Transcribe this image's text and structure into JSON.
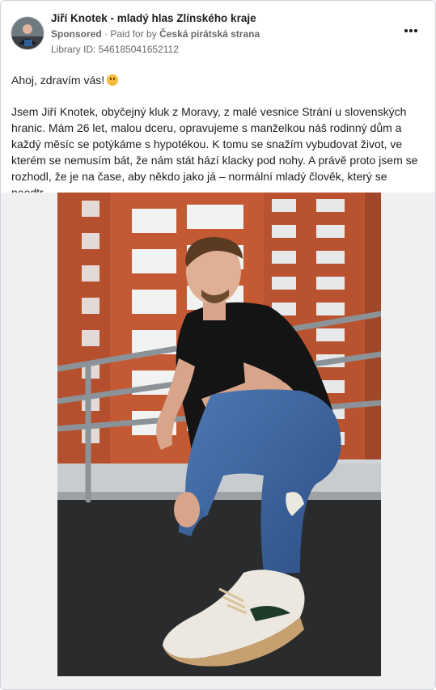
{
  "ad": {
    "page_name": "Jiří Knotek - mladý hlas Zlínského kraje",
    "sponsored_label": "Sponsored",
    "paid_for_prefix": "Paid for by",
    "paid_for_by": "Česká pirátská strana",
    "library_id": "Library ID: 546185041652112",
    "more_options_icon": "ellipsis-icon",
    "avatar_icon": "profile-avatar"
  },
  "post": {
    "greeting": "Ahoj, zdravím vás!",
    "greeting_emoji": "smiling-face-icon",
    "body": "Jsem Jiří Knotek, obyčejný kluk z Moravy, z malé vesnice Strání u slovenských\nhranic. Mám 26 let, malou dceru, opravujeme s manželkou náš rodinný dům a\nkaždý měsíc se potýkáme s hypotékou. K tomu se snažím vybudovat život, ve\nkterém se nemusím bát, že nám stát hází klacky pod nohy. A právě proto jsem se\nrozhodl, že je na čase, aby někdo jako já – normální mladý člověk, který se neodtr…"
  },
  "colors": {
    "secondary_text": "#65676b",
    "primary_text": "#1c1e21",
    "media_background": "#eff0f2"
  }
}
